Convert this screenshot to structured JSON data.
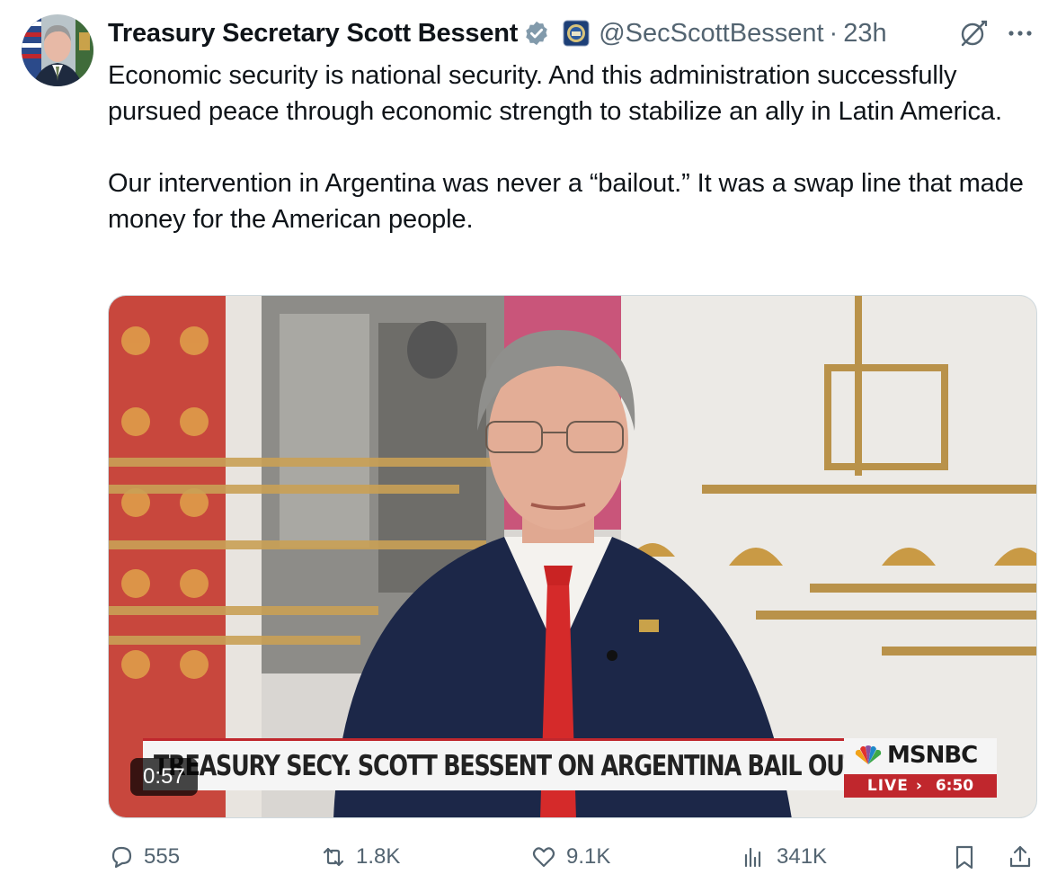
{
  "tweet": {
    "author": {
      "display_name": "Treasury Secretary Scott Bessent",
      "handle": "@SecScottBessent",
      "separator": "·",
      "time": "23h",
      "verified_color": "#829aab"
    },
    "text_paragraphs": [
      "Economic security is national security. And this administration successfully pursued peace through economic strength to stabilize an ally in Latin America.",
      "Our intervention in Argentina was never a “bailout.” It was a swap line that made money for the American people."
    ],
    "media": {
      "type": "video",
      "duration": "0:57",
      "chyron": "TREASURY SECY. SCOTT BESSENT ON ARGENTINA BAIL OUT",
      "network": "MSNBC",
      "live_label": "LIVE",
      "live_arrow": "›",
      "clock": "6:50",
      "accent_color": "#c0272d"
    },
    "metrics": {
      "replies": "555",
      "reposts": "1.8K",
      "likes": "9.1K",
      "views": "341K"
    },
    "icons": [
      "verified-badge-icon",
      "treasury-seal-icon",
      "grok-icon",
      "more-icon",
      "reply-icon",
      "repost-icon",
      "like-icon",
      "views-icon",
      "bookmark-icon",
      "share-icon"
    ]
  }
}
